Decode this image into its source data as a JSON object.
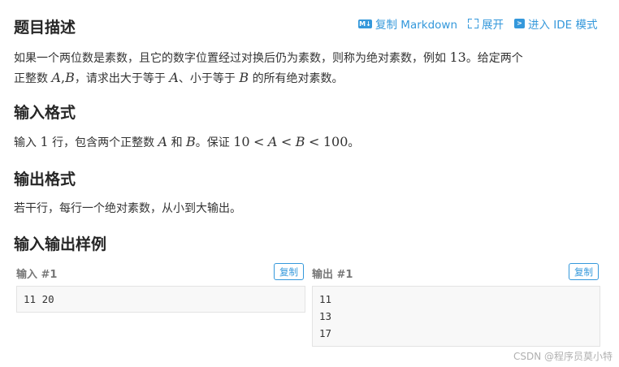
{
  "problem": {
    "heading": "题目描述",
    "desc_p1": "如果一个两位数是素数，且它的数字位置经过对换后仍为素数，则称为绝对素数，例如",
    "desc_num": "13",
    "desc_p2": "。给定两个",
    "desc_p3": "正整数",
    "desc_var_a": "A",
    "desc_comma": ",",
    "desc_var_b": "B",
    "desc_p4": "，请求出大于等于",
    "desc_var_a2": "A",
    "desc_p5": "、小于等于",
    "desc_var_b2": "B",
    "desc_p6": "的所有绝对素数。"
  },
  "toolbar": {
    "copy_md_icon": "markdown-icon",
    "copy_md": "复制 Markdown",
    "expand_icon": "expand-icon",
    "expand": "展开",
    "ide_icon": "terminal-icon",
    "ide": "进入 IDE 模式"
  },
  "input_format": {
    "heading": "输入格式",
    "t1": "输入",
    "n1": "1",
    "t2": "行，包含两个正整数",
    "va": "A",
    "t3": "和",
    "vb": "B",
    "t4": "。保证",
    "n10": "10",
    "lt1": "<",
    "va2": "A",
    "lt2": "<",
    "vb2": "B",
    "lt3": "<",
    "n100": "100",
    "t5": "。"
  },
  "output_format": {
    "heading": "输出格式",
    "text": "若干行，每行一个绝对素数，从小到大输出。"
  },
  "samples": {
    "heading": "输入输出样例",
    "input_label": "输入 #1",
    "output_label": "输出 #1",
    "copy": "复制",
    "input_lines": [
      "11 20"
    ],
    "output_lines": [
      "11",
      "13",
      "17"
    ]
  },
  "watermark": "CSDN @程序员莫小特"
}
